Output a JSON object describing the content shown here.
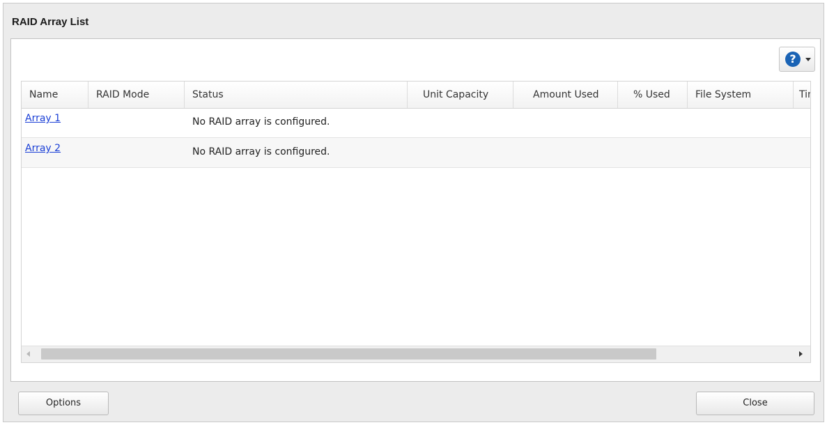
{
  "dialog": {
    "title": "RAID Array List"
  },
  "toolbar": {
    "help_icon": "question-circle-icon",
    "help_glyph": "?"
  },
  "table": {
    "columns": [
      "Name",
      "RAID Mode",
      "Status",
      "Unit Capacity",
      "Amount Used",
      "% Used",
      "File System",
      "Tim"
    ],
    "rows": [
      {
        "name": "Array 1",
        "raid_mode": "",
        "status": "No RAID array is configured."
      },
      {
        "name": "Array 2",
        "raid_mode": "",
        "status": "No RAID array is configured."
      }
    ]
  },
  "buttons": {
    "options": "Options",
    "close": "Close"
  },
  "colors": {
    "link": "#1a3fd6",
    "help_accent": "#1a63b5"
  }
}
